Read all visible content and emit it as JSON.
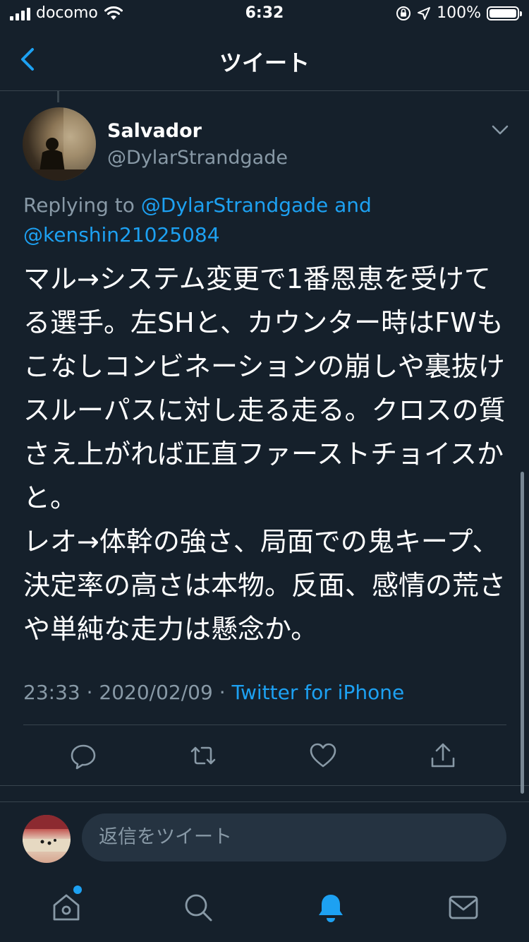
{
  "status_bar": {
    "carrier": "docomo",
    "time": "6:32",
    "battery_percent": "100%",
    "icons": [
      "signal-icon",
      "wifi-icon",
      "orientation-lock-icon",
      "location-icon",
      "battery-icon"
    ]
  },
  "nav": {
    "title": "ツイート",
    "back_icon": "chevron-left-icon"
  },
  "tweet": {
    "author_name": "Salvador",
    "author_handle": "@DylarStrandgade",
    "replying_prefix": "Replying to",
    "replying_to_1": "@DylarStrandgade",
    "replying_and": "and",
    "replying_to_2": "@kenshin21025084",
    "text": "マル→システム変更で1番恩恵を受けてる選手。左SHと、カウンター時はFWもこなしコンビネーションの崩しや裏抜けスルーパスに対し走る走る。クロスの質さえ上がれば正直ファーストチョイスかと。\nレオ→体幹の強さ、局面での鬼キープ、決定率の高さは本物。反面、感情の荒さや単純な走力は懸念か。",
    "time": "23:33",
    "date": "2020/02/09",
    "separator": "·",
    "source": "Twitter for iPhone"
  },
  "actions": [
    "reply-icon",
    "retweet-icon",
    "like-icon",
    "share-icon"
  ],
  "reply_box": {
    "placeholder": "返信をツイート"
  },
  "tab_bar": {
    "items": [
      "home-icon",
      "search-icon",
      "notifications-icon",
      "messages-icon"
    ],
    "active": "notifications-icon"
  },
  "colors": {
    "background": "#15202b",
    "accent": "#1da1f2",
    "secondary_text": "#8899a6",
    "divider": "#38444d",
    "input_background": "#253341"
  }
}
